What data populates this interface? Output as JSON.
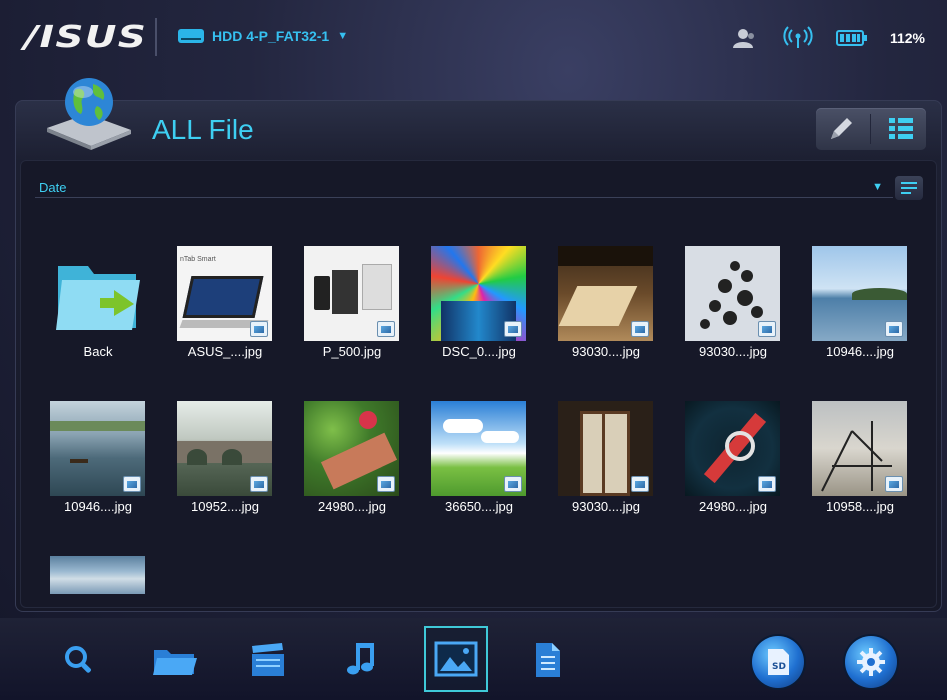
{
  "topbar": {
    "logo": "/ISUS",
    "drive_label": "HDD 4-P_FAT32-1",
    "drive_caret": "▼",
    "battery": "112%"
  },
  "panel": {
    "title": "ALL File",
    "sort_label": "Date",
    "sort_caret": "▼"
  },
  "items": [
    {
      "label": "Back",
      "kind": "back"
    },
    {
      "label": "ASUS_....jpg",
      "kind": "laptop"
    },
    {
      "label": "P_500.jpg",
      "kind": "phone"
    },
    {
      "label": "DSC_0....jpg",
      "kind": "stained"
    },
    {
      "label": "93030....jpg",
      "kind": "room"
    },
    {
      "label": "93030....jpg",
      "kind": "tree"
    },
    {
      "label": "10946....jpg",
      "kind": "lake"
    },
    {
      "label": "10946....jpg",
      "kind": "boat"
    },
    {
      "label": "10952....jpg",
      "kind": "bridge"
    },
    {
      "label": "24980....jpg",
      "kind": "garden"
    },
    {
      "label": "36650....jpg",
      "kind": "sky"
    },
    {
      "label": "93030....jpg",
      "kind": "door"
    },
    {
      "label": "24980....jpg",
      "kind": "coaster"
    },
    {
      "label": "10958....jpg",
      "kind": "pier"
    },
    {
      "label": "",
      "kind": "clouds"
    }
  ],
  "colors": {
    "accent": "#3ecff2",
    "active_border": "#3fc9d8"
  },
  "bottom_nav": [
    {
      "icon": "search-icon"
    },
    {
      "icon": "folder-icon"
    },
    {
      "icon": "video-icon"
    },
    {
      "icon": "music-icon"
    },
    {
      "icon": "image-icon",
      "active": true
    },
    {
      "icon": "document-icon"
    },
    {
      "icon": "sd-card-icon"
    },
    {
      "icon": "settings-gear-icon"
    }
  ]
}
